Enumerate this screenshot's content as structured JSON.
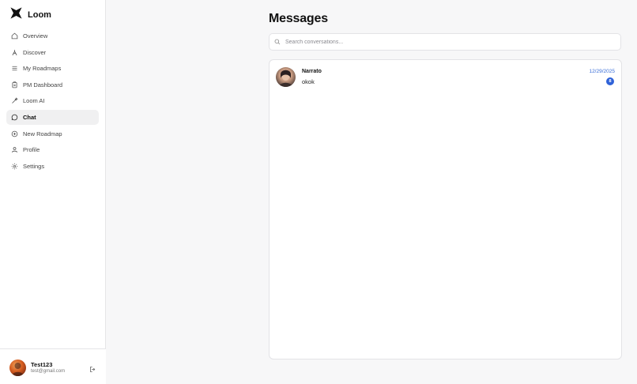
{
  "app": {
    "name": "Loom"
  },
  "sidebar": {
    "items": [
      {
        "label": "Overview",
        "icon": "home-icon"
      },
      {
        "label": "Discover",
        "icon": "compass-icon"
      },
      {
        "label": "My Roadmaps",
        "icon": "list-icon"
      },
      {
        "label": "PM Dashboard",
        "icon": "clipboard-icon"
      },
      {
        "label": "Loom AI",
        "icon": "sparkle-pen-icon"
      },
      {
        "label": "Chat",
        "icon": "chat-bubble-icon",
        "active": true
      },
      {
        "label": "New Roadmap",
        "icon": "plus-circle-icon"
      },
      {
        "label": "Profile",
        "icon": "user-icon"
      },
      {
        "label": "Settings",
        "icon": "gear-icon"
      }
    ]
  },
  "user": {
    "name": "Test123",
    "email": "test@gmail.com"
  },
  "main": {
    "title": "Messages",
    "search": {
      "placeholder": "Search conversations...",
      "value": ""
    },
    "conversations": [
      {
        "name": "Narrato",
        "last_message": "okok",
        "date": "12/29/2025",
        "unread": "8"
      }
    ]
  },
  "colors": {
    "accent": "#2f62d8",
    "date": "#3b6fd8",
    "active_nav": "#f0f0f1"
  }
}
